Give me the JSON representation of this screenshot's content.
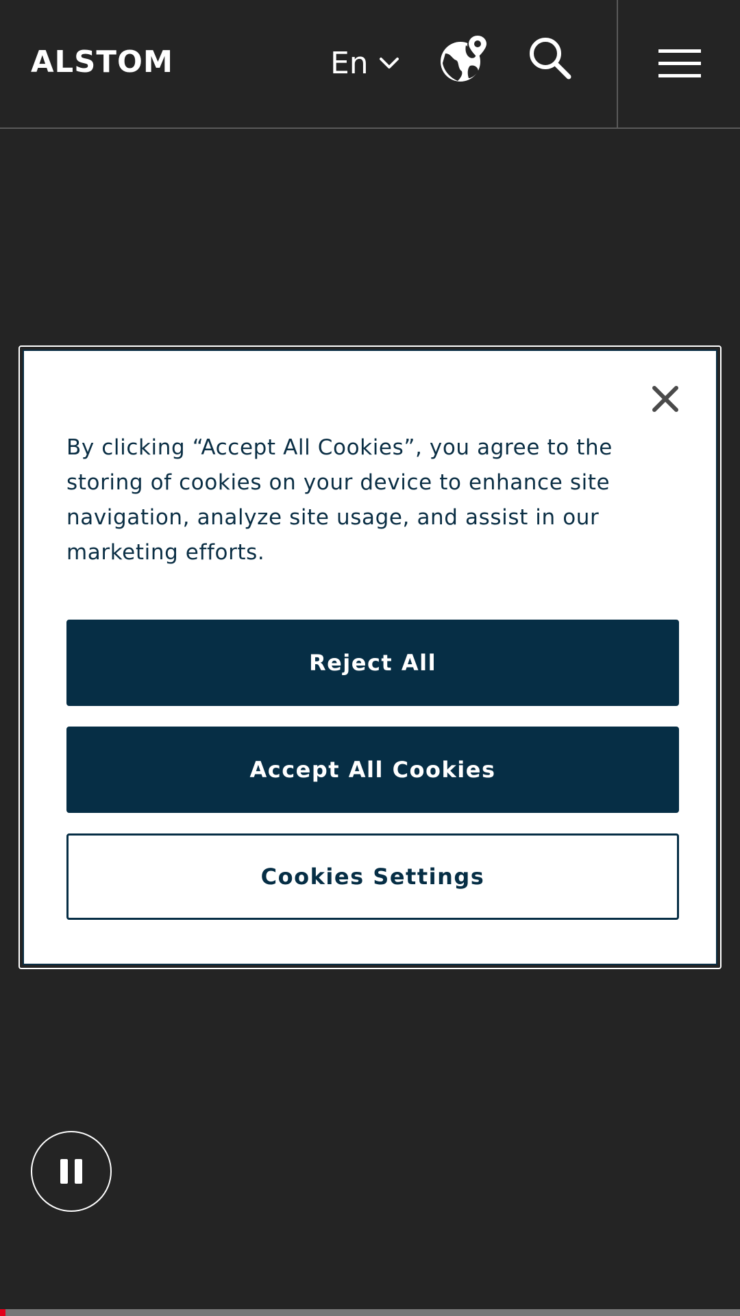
{
  "header": {
    "logo_text": "ALSTOM",
    "language": "En",
    "icons": {
      "language_chevron": "chevron-down-icon",
      "globe": "globe-location-icon",
      "search": "search-icon",
      "menu": "hamburger-menu-icon"
    }
  },
  "cookie_banner": {
    "text": "By clicking “Accept All Cookies”, you agree to the storing of cookies on your device to enhance site navigation, analyze site usage, and assist in our marketing efforts.",
    "close_icon": "close-icon",
    "reject_label": "Reject All",
    "accept_label": "Accept All Cookies",
    "settings_label": "Cookies Settings"
  },
  "media": {
    "pause_icon": "pause-icon",
    "progress_fraction": 0.007
  },
  "colors": {
    "background": "#242424",
    "brand_navy": "#062e45",
    "progress_accent": "#e2001a",
    "white": "#ffffff"
  }
}
